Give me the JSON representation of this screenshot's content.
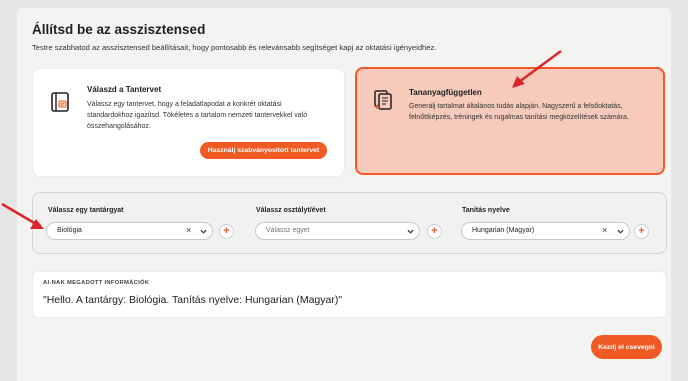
{
  "header": {
    "title": "Állítsd be az asszisztensed",
    "subtitle": "Testre szabhatod az asszisztensed beállításait, hogy pontosabb és relevánsabb segítséget kapj az oktatási igényeidhez."
  },
  "cards": {
    "tanterv": {
      "title": "Válaszd a Tantervet",
      "text": "Válassz egy tantervet, hogy a feladatlapodat a konkrét oktatási standardokhoz igazítsd. Tökéletes a tartalom nemzeti tantervekkel való összehangolásához.",
      "button": "Használj szabványosított tantervet",
      "icon": "curriculum-book-icon"
    },
    "tananyag": {
      "title": "Tananyagfüggetlen",
      "text": "Generálj tartalmat általános tudás alapján. Nagyszerű a felsőoktatás, felnőttképzés, tréningek és rugalmas tanítási megközelítések számára.",
      "icon": "documents-sparkle-icon",
      "selected": true
    }
  },
  "selectors": {
    "subject": {
      "label": "Válassz egy tantárgyat",
      "value": "Biológia"
    },
    "grade": {
      "label": "Válassz osztályt/évet",
      "placeholder": "Válassz egyet"
    },
    "language": {
      "label": "Tanítás nyelve",
      "value": "Hungarian (Magyar)"
    },
    "clear_glyph": "×",
    "add_glyph": "+"
  },
  "info": {
    "label": "AI-NAK MEGADOTT INFORMÁCIÓK",
    "text": "\"Hello. A tantárgy: Biológia. Tanítás nyelve: Hungarian (Magyar)\""
  },
  "start_button": "Kezdj el csevegni",
  "colors": {
    "accent": "#f05a23",
    "selected_card_bg": "#f6cbbb",
    "annotation_arrow": "#d9262c"
  }
}
